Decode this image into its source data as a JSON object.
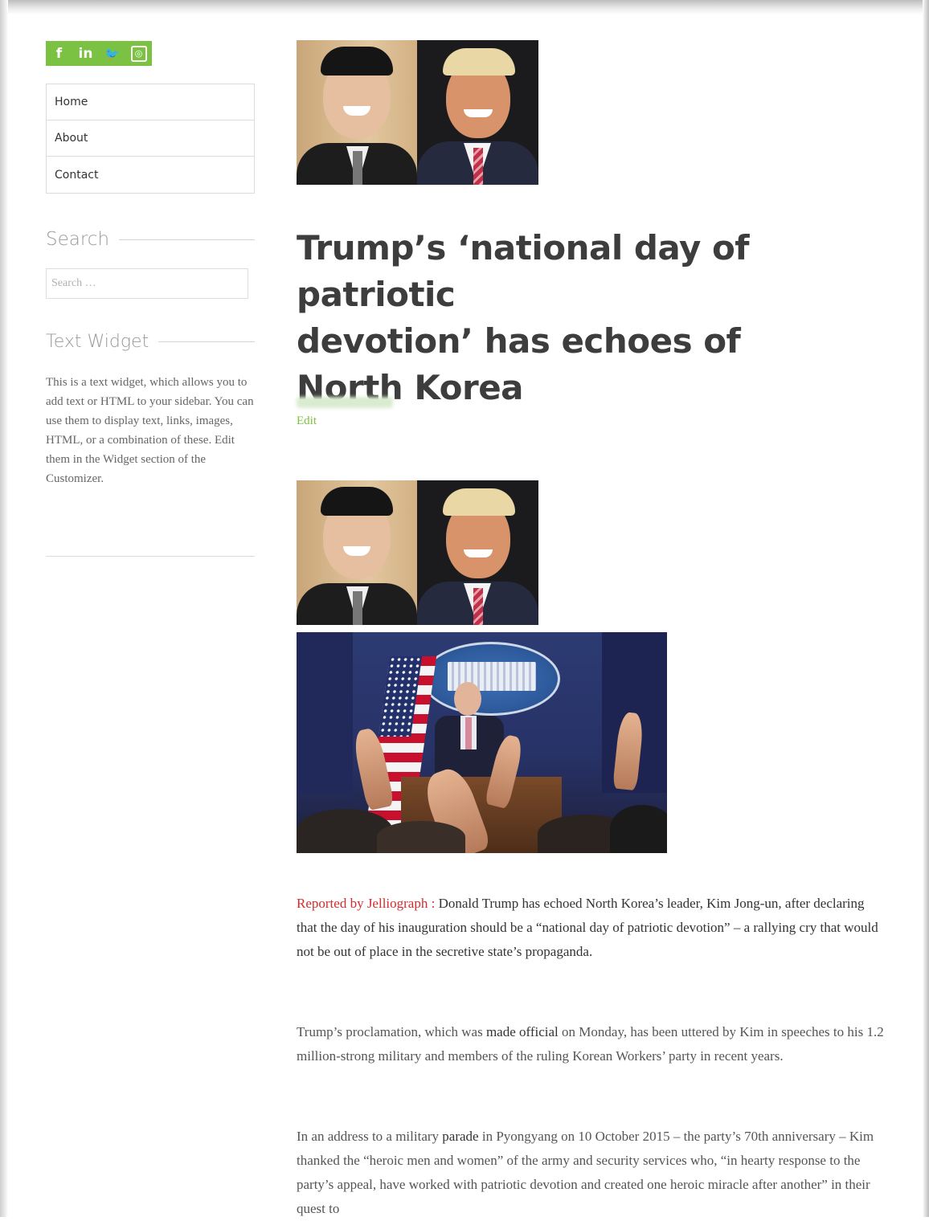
{
  "social": {
    "icons": [
      "facebook-icon",
      "linkedin-icon",
      "twitter-icon",
      "instagram-icon"
    ],
    "glyphs": [
      "f",
      "in",
      "🐦",
      "◎"
    ],
    "color": "#7bc243"
  },
  "menu": {
    "items": [
      "Home",
      "About",
      "Contact"
    ]
  },
  "search": {
    "title": "Search",
    "placeholder": "Search …"
  },
  "text_widget": {
    "title": "Text Widget",
    "body": "This is a text widget, which allows you to add text or HTML to your sidebar. You can use them to display text, links, images, HTML, or a combination of these. Edit them in the Widget section of the Customizer."
  },
  "post": {
    "title_lines": [
      "Trump’s ‘national day of patriotic",
      "devotion’ has echoes of",
      "North Korea"
    ],
    "edit_label": "Edit",
    "accent_color": "#7bc243",
    "reported_prefix": "Reported by Jelliograph :",
    "paragraphs": [
      {
        "lead": "Donald Trump has echoed North Korea’s leader, Kim Jong-un, after declaring that the day of his inauguration should be a “national day of patriotic devotion” – a rallying cry that would not be out of place in the secretive state’s propaganda."
      },
      {
        "before": "Trump’s proclamation, which was ",
        "link": "made official",
        "after": " on Monday, has been uttered by Kim in speeches to his 1.2 million-strong military and members of the ruling Korean Workers’ party in recent years."
      },
      {
        "before": "In an address to a military ",
        "link": "parade",
        "after": " in Pyongyang on 10 October 2015 – the party’s 70th anniversary – Kim thanked the “heroic men and women” of the army and security services who, “in hearty response to the party’s appeal, have worked with patriotic devotion and created one heroic miracle after another” in their quest to"
      }
    ]
  }
}
